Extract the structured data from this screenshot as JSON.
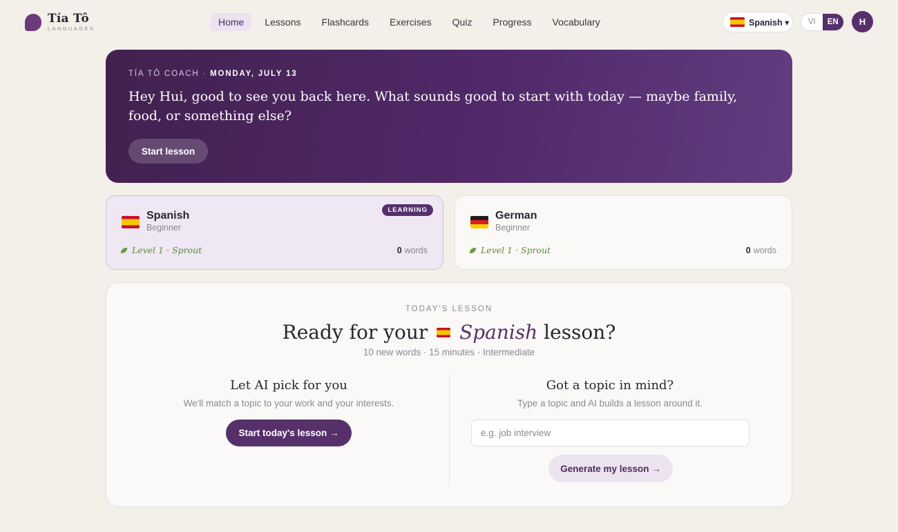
{
  "brand": {
    "name": "Tía Tô",
    "sub": "LANGUAGES"
  },
  "nav": [
    {
      "label": "Home",
      "active": true
    },
    {
      "label": "Lessons"
    },
    {
      "label": "Flashcards"
    },
    {
      "label": "Exercises"
    },
    {
      "label": "Quiz"
    },
    {
      "label": "Progress"
    },
    {
      "label": "Vocabulary"
    }
  ],
  "language_select": {
    "value": "Spanish ▾"
  },
  "ui_language": {
    "options": [
      "VI",
      "EN"
    ],
    "selected": "EN"
  },
  "user": {
    "initial": "H"
  },
  "hero": {
    "eyebrow": "TÍA TÔ COACH · ",
    "date": "MONDAY, JULY 13",
    "message": "Hey Hui, good to see you back here. What sounds good to start with today — maybe family, food, or something else?",
    "button": "Start lesson"
  },
  "cards": [
    {
      "language": "Spanish",
      "level": "Beginner",
      "badge": "LEARNING",
      "stage": "Level 1 · Sprout",
      "word_count": "0",
      "words_label": "words"
    },
    {
      "language": "German",
      "level": "Beginner",
      "stage": "Level 1 · Sprout",
      "word_count": "0",
      "words_label": "words"
    }
  ],
  "lesson": {
    "eyebrow": "TODAY'S LESSON",
    "title_prefix": "Ready for your ",
    "title_lang": "Spanish",
    "title_suffix": " lesson?",
    "meta": "10 new words · 15 minutes · Intermediate",
    "ai": {
      "title": "Let AI pick for you",
      "desc": "We'll match a topic to your work and your interests.",
      "button": "Start today's lesson →"
    },
    "topic": {
      "title": "Got a topic in mind?",
      "desc": "Type a topic and AI builds a lesson around it.",
      "placeholder": "e.g. job interview",
      "value": "",
      "button": "Generate my lesson →"
    }
  },
  "colors": {
    "accent": "#55306b",
    "background": "#f3efe9",
    "sprout": "#5c8a3a"
  }
}
